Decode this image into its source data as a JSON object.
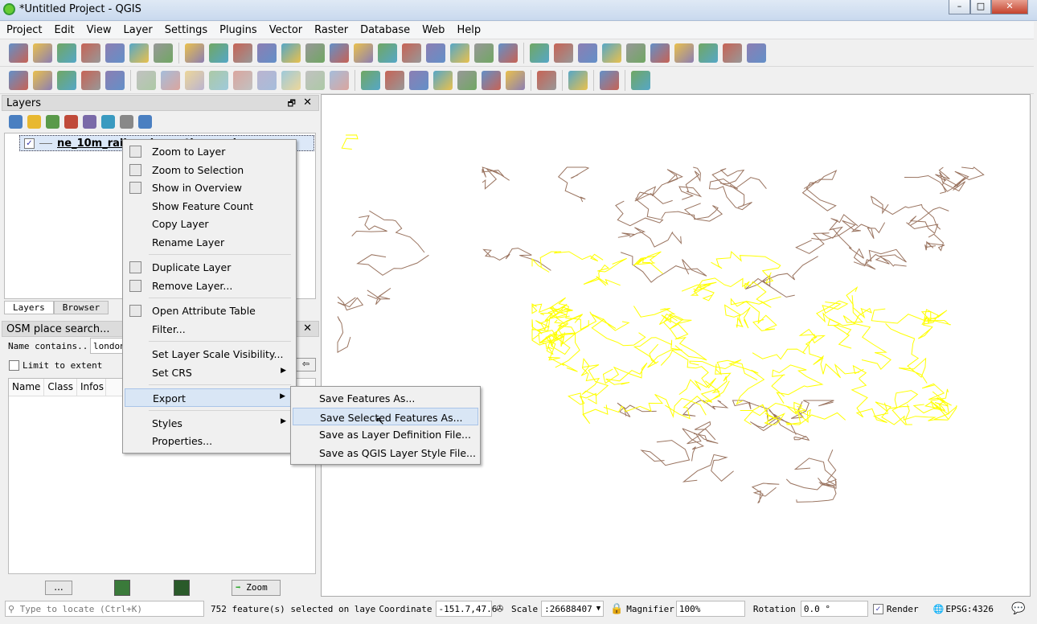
{
  "window": {
    "title": "*Untitled Project - QGIS",
    "controls": [
      "–",
      "□",
      "✕"
    ]
  },
  "menubar": [
    "Project",
    "Edit",
    "View",
    "Layer",
    "Settings",
    "Plugins",
    "Vector",
    "Raster",
    "Database",
    "Web",
    "Help"
  ],
  "toolbar1": [
    "new-project",
    "open-project",
    "save-project",
    "save-as",
    "print-composer",
    "composer-manager",
    "style-manager",
    "|",
    "pan",
    "pan-to-selection",
    "zoom-in",
    "zoom-out",
    "zoom-native",
    "zoom-full",
    "zoom-to-selection",
    "zoom-to-layer",
    "zoom-last",
    "zoom-next",
    "new-bookmark",
    "show-bookmarks",
    "map-tips",
    "refresh",
    "|",
    "identify",
    "action",
    "select",
    "deselect",
    "attribute-table",
    "field-calculator",
    "statistics",
    "measure",
    "annotation",
    "text-annotation"
  ],
  "toolbar2": [
    "add-vector",
    "add-raster",
    "digitize",
    "edit-pencil",
    "save-edits",
    "|",
    "add-feature",
    "move-feature",
    "node-tool",
    "delete-selected",
    "cut",
    "copy",
    "paste",
    "undo",
    "redo",
    "|",
    "label",
    "label-toolbar",
    "pin-labels",
    "show-hide-labels",
    "move-label",
    "rotate-label",
    "change-label",
    "|",
    "osm-plugin",
    "|",
    "python-console",
    "|",
    "help",
    "|",
    "georeferencer"
  ],
  "layers_panel": {
    "title": "Layers",
    "tools": [
      "paint-brush",
      "add-group",
      "eye-visibility",
      "filter",
      "expression-filter",
      "expand-all",
      "collapse-all",
      "remove-layer"
    ],
    "layer_name": "ne_10m_railroads_north_america",
    "layer_checked": true
  },
  "tabs": [
    "Layers",
    "Browser"
  ],
  "osm": {
    "title": "OSM place search...",
    "name_label": "Name contains...",
    "name_value": "london",
    "limit_label": "Limit to extent",
    "columns": [
      "Name",
      "Class",
      "Infos"
    ],
    "buttons": {
      "more": "...",
      "zoom": "Zoom",
      "back": "⇦"
    }
  },
  "context_menu": [
    {
      "label": "Zoom to Layer",
      "u": "Z",
      "icon": "zoom-layer-icon"
    },
    {
      "label": "Zoom to Selection",
      "u": "Z",
      "icon": "zoom-selection-icon"
    },
    {
      "label": "Show in Overview",
      "u": "S",
      "icon": "overview-icon"
    },
    {
      "label": "Show Feature Count"
    },
    {
      "label": "Copy Layer"
    },
    {
      "label": "Rename Layer",
      "u": "n"
    },
    {
      "sep": true
    },
    {
      "label": "Duplicate Layer",
      "u": "D",
      "icon": "duplicate-icon"
    },
    {
      "label": "Remove Layer...",
      "u": "R",
      "icon": "remove-icon"
    },
    {
      "sep": true
    },
    {
      "label": "Open Attribute Table",
      "u": "O",
      "icon": "table-icon"
    },
    {
      "label": "Filter...",
      "u": "F"
    },
    {
      "sep": true
    },
    {
      "label": "Set Layer Scale Visibility...",
      "u": "S"
    },
    {
      "label": "Set CRS",
      "submenu": true
    },
    {
      "sep": true
    },
    {
      "label": "Export",
      "submenu": true,
      "highlight": true
    },
    {
      "sep": true
    },
    {
      "label": "Styles",
      "submenu": true
    },
    {
      "label": "Properties...",
      "u": "P"
    }
  ],
  "export_menu": [
    {
      "label": "Save Features As..."
    },
    {
      "label": "Save Selected Features As...",
      "highlight": true
    },
    {
      "label": "Save as Layer Definition File..."
    },
    {
      "label": "Save as QGIS Layer Style File..."
    }
  ],
  "status": {
    "locate_placeholder": "Type to locate (Ctrl+K)",
    "message": "752 feature(s) selected on laye",
    "coordinate_label": "Coordinate",
    "coordinate": "-151.7,47.6",
    "scale_label": "Scale",
    "scale": ":26688407",
    "magnifier_label": "Magnifier",
    "magnifier": "100%",
    "rotation_label": "Rotation",
    "rotation": "0.0 °",
    "render_label": "Render",
    "render_checked": true,
    "crs": "EPSG:4326"
  },
  "colors": {
    "selected": "#ffff00",
    "railroads": "#9a7460"
  }
}
